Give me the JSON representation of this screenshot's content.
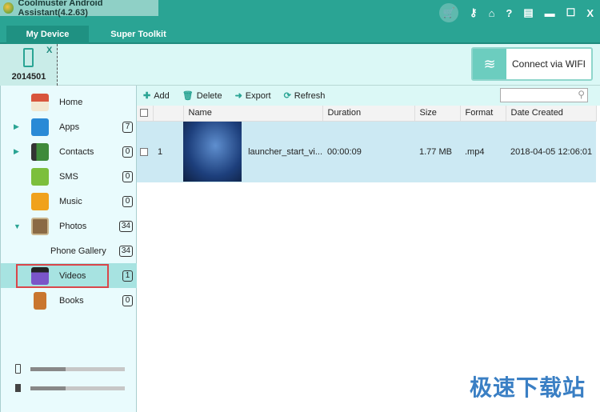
{
  "app": {
    "title": "Coolmuster Android Assistant(4.2.63)"
  },
  "window_buttons": [
    "cart-icon",
    "key-icon",
    "home-icon",
    "help-icon",
    "feedback-icon",
    "minimize-icon",
    "maximize-icon",
    "close-icon"
  ],
  "window_glyphs": {
    "key": "⚷",
    "home": "⌂",
    "help": "?",
    "feedback": "▤",
    "min": "▬",
    "max": "☐",
    "close": "X"
  },
  "tabs": [
    {
      "label": "My Device",
      "active": true
    },
    {
      "label": "Super Toolkit",
      "active": false
    }
  ],
  "device": {
    "name": "2014501",
    "close": "X"
  },
  "wifi_button": {
    "label": "Connect via WIFI"
  },
  "sidebar": {
    "items": [
      {
        "label": "Home",
        "count": null
      },
      {
        "label": "Apps",
        "count": "7"
      },
      {
        "label": "Contacts",
        "count": "0"
      },
      {
        "label": "SMS",
        "count": "0"
      },
      {
        "label": "Music",
        "count": "0"
      },
      {
        "label": "Photos",
        "count": "34"
      },
      {
        "label": "Phone Gallery",
        "count": "34"
      },
      {
        "label": "Videos",
        "count": "1",
        "selected": true
      },
      {
        "label": "Books",
        "count": "0"
      }
    ],
    "storage": {
      "phone_used": 0.37,
      "sd_used": 0.37
    }
  },
  "toolbar": {
    "add": "Add",
    "delete": "Delete",
    "export": "Export",
    "refresh": "Refresh",
    "search_placeholder": ""
  },
  "table": {
    "headers": [
      "Name",
      "Duration",
      "Size",
      "Format",
      "Date Created"
    ],
    "rows": [
      {
        "index": "1",
        "name": "launcher_start_vi...",
        "duration": "00:00:09",
        "size": "1.77 MB",
        "format": ".mp4",
        "date": "2018-04-05 12:06:01"
      }
    ]
  },
  "watermark": "极速下载站",
  "colors": {
    "accent": "#2aa494",
    "selected_row": "#cce9f3",
    "selection_outline": "#d9464a"
  }
}
